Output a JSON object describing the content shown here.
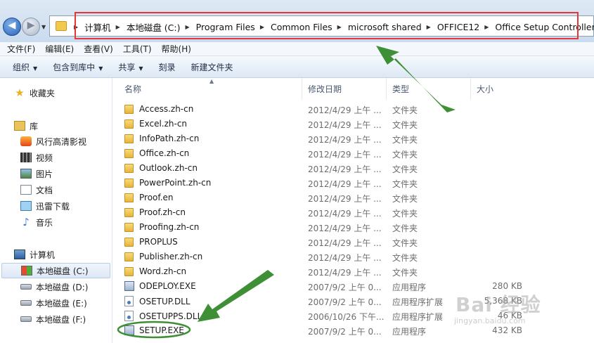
{
  "address_bar": {
    "crumbs": [
      "计算机",
      "本地磁盘 (C:)",
      "Program Files",
      "Common Files",
      "microsoft shared",
      "OFFICE12",
      "Office Setup Controller"
    ]
  },
  "menu": [
    "文件(F)",
    "编辑(E)",
    "查看(V)",
    "工具(T)",
    "帮助(H)"
  ],
  "toolbar": {
    "organize": "组织",
    "include_library": "包含到库中",
    "share": "共享",
    "burn": "刻录",
    "new_folder": "新建文件夹"
  },
  "nav": {
    "favorites": "收藏夹",
    "libraries": "库",
    "library_items": [
      "风行高清影视",
      "视频",
      "图片",
      "文档",
      "迅雷下载",
      "音乐"
    ],
    "computer": "计算机",
    "drives": [
      "本地磁盘 (C:)",
      "本地磁盘 (D:)",
      "本地磁盘 (E:)",
      "本地磁盘 (F:)"
    ]
  },
  "columns": [
    "名称",
    "修改日期",
    "类型",
    "大小"
  ],
  "files": [
    {
      "name": "Access.zh-cn",
      "date": "2012/4/29 上午 ...",
      "type": "文件夹",
      "size": "",
      "kind": "folder"
    },
    {
      "name": "Excel.zh-cn",
      "date": "2012/4/29 上午 ...",
      "type": "文件夹",
      "size": "",
      "kind": "folder"
    },
    {
      "name": "InfoPath.zh-cn",
      "date": "2012/4/29 上午 ...",
      "type": "文件夹",
      "size": "",
      "kind": "folder"
    },
    {
      "name": "Office.zh-cn",
      "date": "2012/4/29 上午 ...",
      "type": "文件夹",
      "size": "",
      "kind": "folder"
    },
    {
      "name": "Outlook.zh-cn",
      "date": "2012/4/29 上午 ...",
      "type": "文件夹",
      "size": "",
      "kind": "folder"
    },
    {
      "name": "PowerPoint.zh-cn",
      "date": "2012/4/29 上午 ...",
      "type": "文件夹",
      "size": "",
      "kind": "folder"
    },
    {
      "name": "Proof.en",
      "date": "2012/4/29 上午 ...",
      "type": "文件夹",
      "size": "",
      "kind": "folder"
    },
    {
      "name": "Proof.zh-cn",
      "date": "2012/4/29 上午 ...",
      "type": "文件夹",
      "size": "",
      "kind": "folder"
    },
    {
      "name": "Proofing.zh-cn",
      "date": "2012/4/29 上午 ...",
      "type": "文件夹",
      "size": "",
      "kind": "folder"
    },
    {
      "name": "PROPLUS",
      "date": "2012/4/29 上午 ...",
      "type": "文件夹",
      "size": "",
      "kind": "folder"
    },
    {
      "name": "Publisher.zh-cn",
      "date": "2012/4/29 上午 ...",
      "type": "文件夹",
      "size": "",
      "kind": "folder"
    },
    {
      "name": "Word.zh-cn",
      "date": "2012/4/29 上午 ...",
      "type": "文件夹",
      "size": "",
      "kind": "folder"
    },
    {
      "name": "ODEPLOY.EXE",
      "date": "2007/9/2 上午 0...",
      "type": "应用程序",
      "size": "280 KB",
      "kind": "exe"
    },
    {
      "name": "OSETUP.DLL",
      "date": "2007/9/2 上午 0...",
      "type": "应用程序扩展",
      "size": "5,368 KB",
      "kind": "dll"
    },
    {
      "name": "OSETUPPS.DLL",
      "date": "2006/10/26 下午...",
      "type": "应用程序扩展",
      "size": "46 KB",
      "kind": "dll"
    },
    {
      "name": "SETUP.EXE",
      "date": "2007/9/2 上午 0...",
      "type": "应用程序",
      "size": "432 KB",
      "kind": "exe"
    }
  ],
  "watermark": {
    "brand": "Bai 经验",
    "url": "jingyan.baidu.com"
  },
  "colors": {
    "highlight_box": "#e8353a",
    "arrow": "#3f8f36",
    "circle": "#3f8f36"
  }
}
